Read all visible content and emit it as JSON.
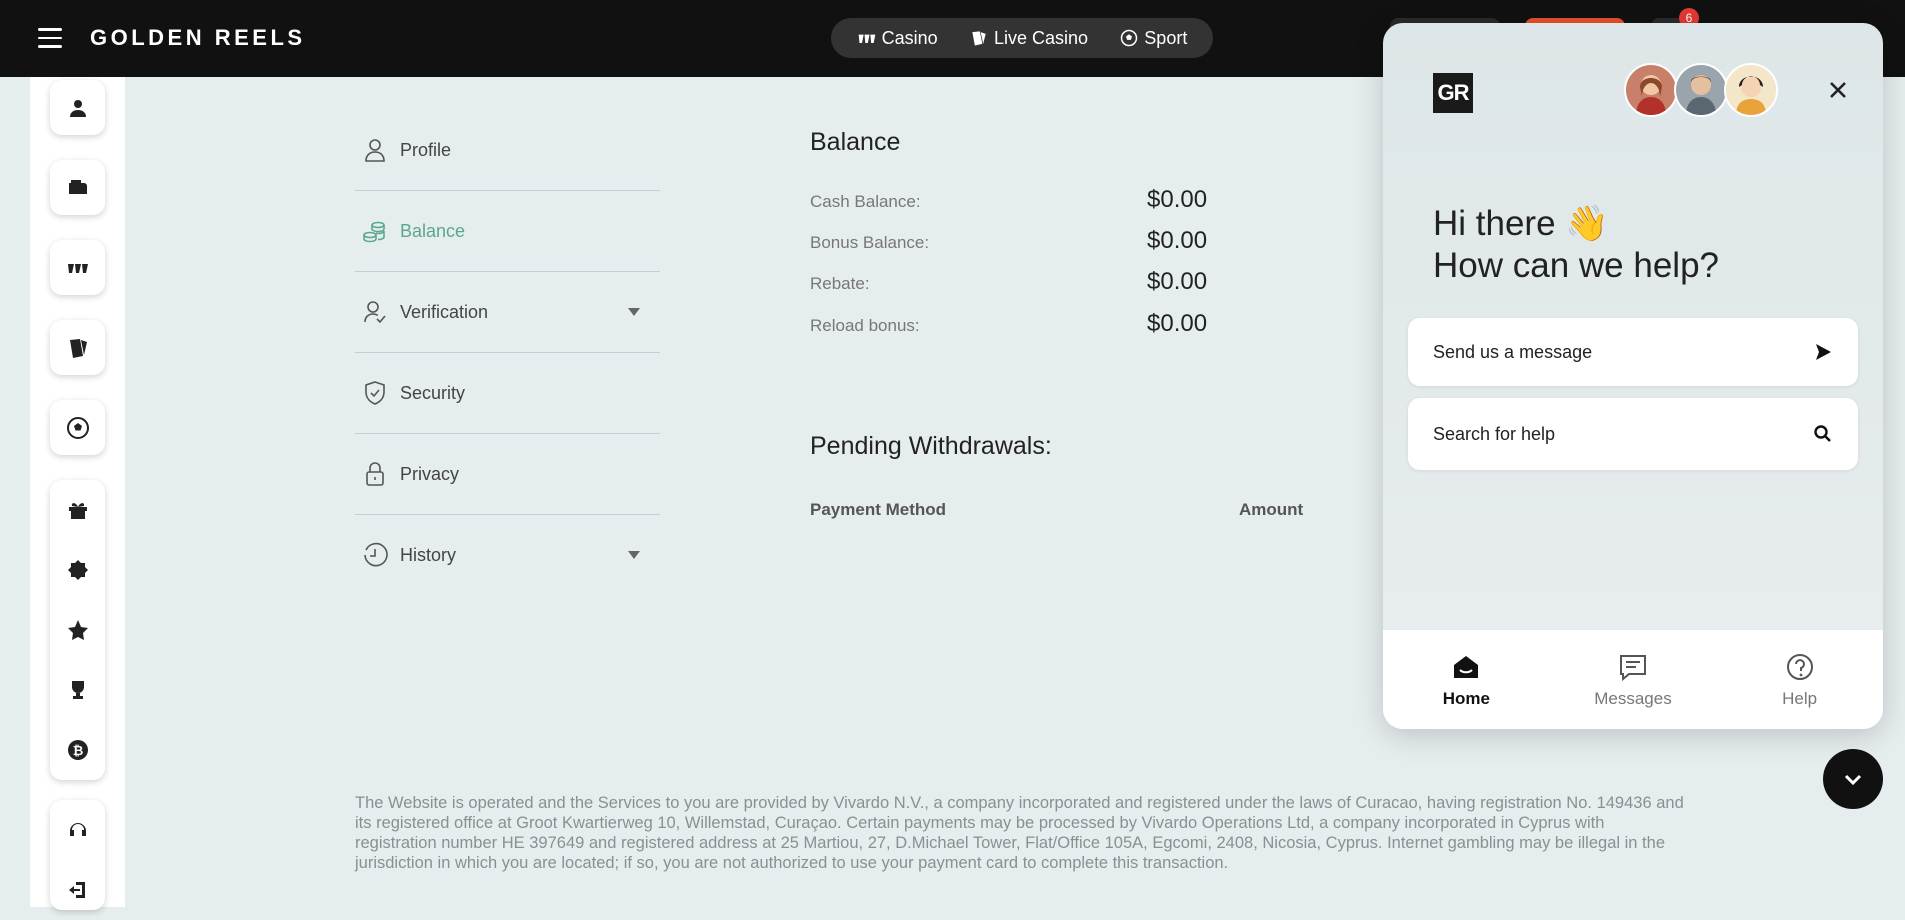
{
  "header": {
    "brand": "GOLDEN REELS",
    "nav": [
      {
        "label": "Casino",
        "icon": "slots-icon"
      },
      {
        "label": "Live Casino",
        "icon": "cards-icon"
      },
      {
        "label": "Sport",
        "icon": "soccer-ball-icon"
      }
    ],
    "notification_count": "6"
  },
  "sidebar": {
    "icons": [
      "user-icon",
      "wallet-icon",
      "slots-icon",
      "cards-icon",
      "soccer-ball-icon",
      "gift-icon",
      "promo-badge-icon",
      "star-icon",
      "trophy-icon",
      "bitcoin-icon",
      "support-icon",
      "logout-icon"
    ]
  },
  "account_menu": {
    "items": [
      {
        "label": "Profile",
        "icon": "user-outline-icon"
      },
      {
        "label": "Balance",
        "icon": "coins-icon",
        "active": true
      },
      {
        "label": "Verification",
        "icon": "user-check-icon",
        "expandable": true
      },
      {
        "label": "Security",
        "icon": "shield-icon"
      },
      {
        "label": "Privacy",
        "icon": "lock-icon"
      },
      {
        "label": "History",
        "icon": "clock-icon",
        "expandable": true
      }
    ]
  },
  "balance": {
    "title": "Balance",
    "rows": [
      {
        "label": "Cash Balance:",
        "value": "$0.00"
      },
      {
        "label": "Bonus Balance:",
        "value": "$0.00"
      },
      {
        "label": "Rebate:",
        "value": "$0.00"
      },
      {
        "label": "Reload bonus:",
        "value": "$0.00"
      }
    ]
  },
  "pending": {
    "title": "Pending Withdrawals:",
    "columns": [
      "Payment Method",
      "Amount"
    ]
  },
  "footer": {
    "text": "The Website is operated and the Services to you are provided by Vivardo N.V., a company incorporated and registered under the laws of Curacao, having registration No. 149436 and its registered office at Groot Kwartierweg 10, Willemstad, Curaçao. Certain payments may be processed by Vivardo Operations Ltd, a company incorporated in Cyprus with registration number HE 397649 and registered address at 25 Martiou, 27, D.Michael Tower, Flat/Office 105A, Egcomi, 2408, Nicosia, Cyprus. Internet gambling may be illegal in the jurisdiction in which you are located; if so, you are not authorized to use your payment card to complete this transaction."
  },
  "chat": {
    "logo": "GR",
    "greeting_line1": "Hi there 👋",
    "greeting_line2": "How can we help?",
    "send_message": "Send us a message",
    "search_help": "Search for help",
    "tabs": [
      {
        "label": "Home",
        "active": true
      },
      {
        "label": "Messages"
      },
      {
        "label": "Help"
      }
    ]
  },
  "colors": {
    "accent": "#5aa88c",
    "header_bg": "#111111",
    "page_bg": "#e6edef"
  }
}
